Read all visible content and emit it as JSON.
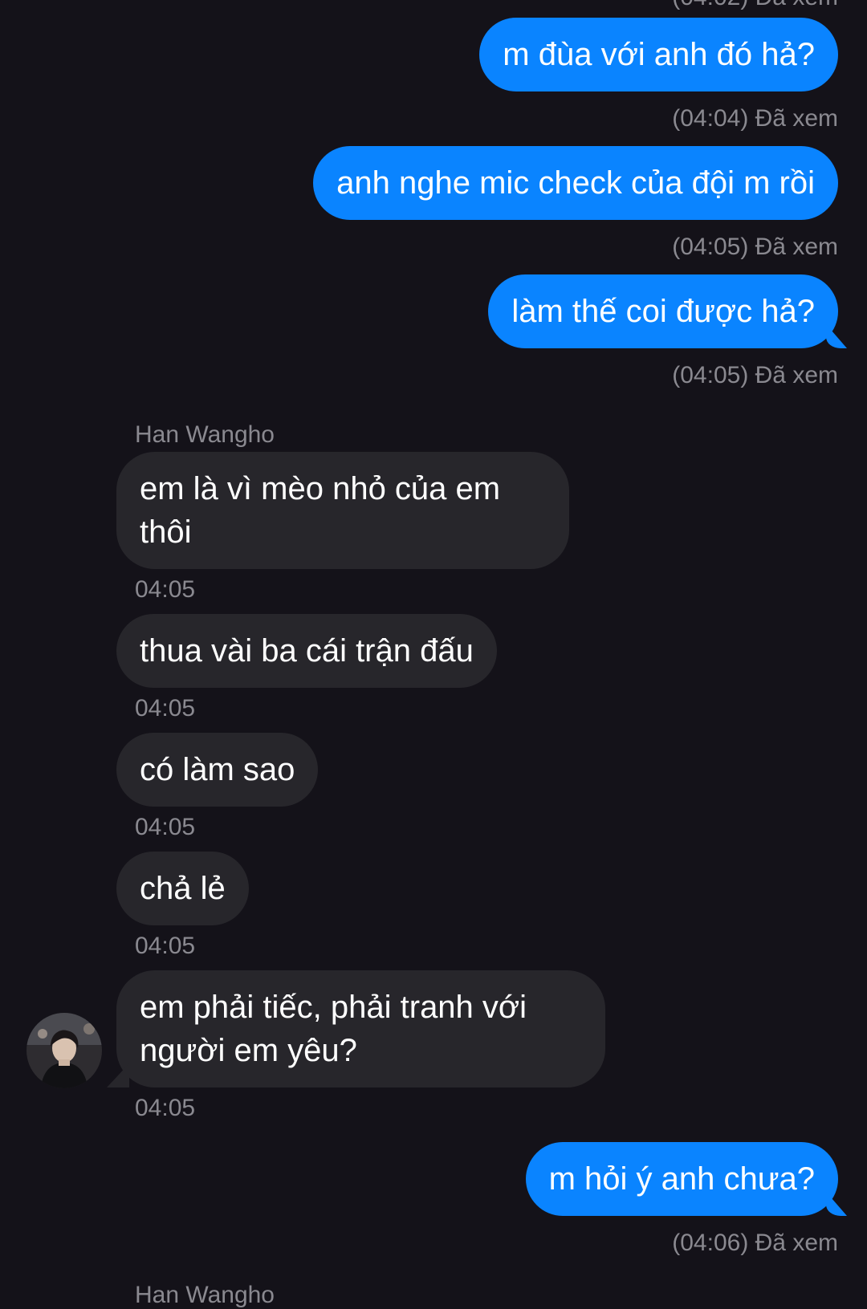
{
  "thread": {
    "top_cut_meta": "(04:02) Đã xem",
    "partner_name": "Han Wangho",
    "bottom_cut_name": "Han Wangho",
    "avatar_icon": "contact-photo-avatar",
    "colors": {
      "background": "#141219",
      "outgoing_bubble": "#0a84ff",
      "incoming_bubble": "#27262b",
      "meta_text": "#8a8990"
    },
    "outgoing": [
      {
        "text": "m đùa với anh đó hả?",
        "meta": "(04:04) Đã xem"
      },
      {
        "text": "anh nghe mic check của đội m rồi",
        "meta": "(04:05) Đã xem"
      },
      {
        "text": "làm thế coi được hả?",
        "meta": "(04:05) Đã xem"
      },
      {
        "text": "m hỏi ý anh chưa?",
        "meta": "(04:06) Đã xem"
      }
    ],
    "incoming": [
      {
        "text": "em là vì mèo nhỏ của em thôi",
        "time": "04:05"
      },
      {
        "text": "thua vài ba cái trận đấu",
        "time": "04:05"
      },
      {
        "text": "có làm sao",
        "time": "04:05"
      },
      {
        "text": "chả lẻ",
        "time": "04:05"
      },
      {
        "text": "em phải tiếc, phải tranh với người em yêu?",
        "time": "04:05"
      }
    ]
  }
}
